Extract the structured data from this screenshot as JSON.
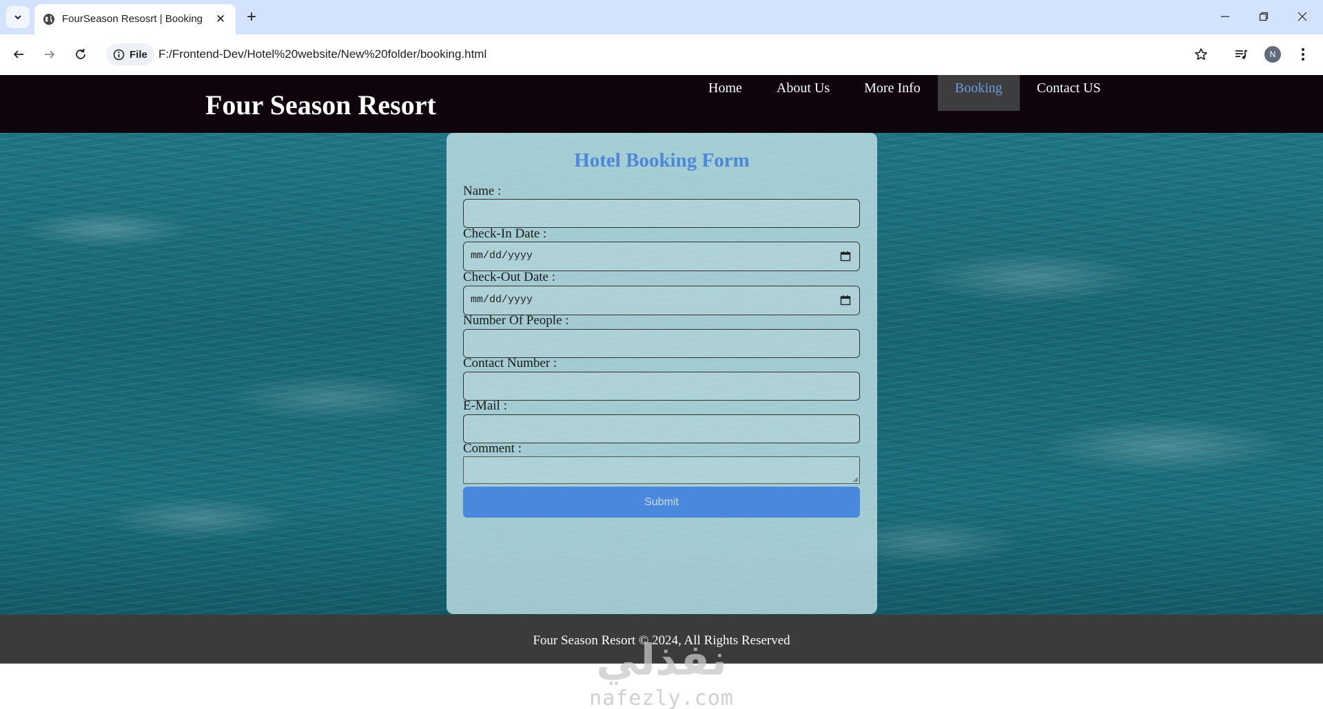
{
  "browser": {
    "tab_title": "FourSeason Resosrt | Booking",
    "site_info_label": "File",
    "url": "F:/Frontend-Dev/Hotel%20website/New%20folder/booking.html",
    "profile_initial": "N"
  },
  "header": {
    "brand": "Four Season Resort",
    "nav": [
      {
        "label": "Home",
        "active": false
      },
      {
        "label": "About Us",
        "active": false
      },
      {
        "label": "More Info",
        "active": false
      },
      {
        "label": "Booking",
        "active": true
      },
      {
        "label": "Contact US",
        "active": false
      }
    ]
  },
  "form": {
    "title": "Hotel Booking Form",
    "name_label": "Name :",
    "checkin_label": "Check-In Date :",
    "checkin_value": "mm/dd/yyyy",
    "checkout_label": "Check-Out Date :",
    "checkout_value": "mm/dd/yyyy",
    "people_label": "Number Of People :",
    "contact_label": "Contact Number :",
    "email_label": "E-Mail :",
    "comment_label": "Comment :",
    "submit_label": "Submit"
  },
  "footer": {
    "text": "Four Season Resort © 2024, All Rights Reserved"
  },
  "watermark": {
    "arabic": "نفذلي",
    "latin": "nafezly.com"
  },
  "colors": {
    "header_bg": "#0f040b",
    "nav_active_bg": "#3d3d3f",
    "nav_active_text": "#6e9be0",
    "form_title": "#4c87da",
    "submit_bg": "#4a88dd",
    "footer_bg": "#3b3b3b"
  }
}
